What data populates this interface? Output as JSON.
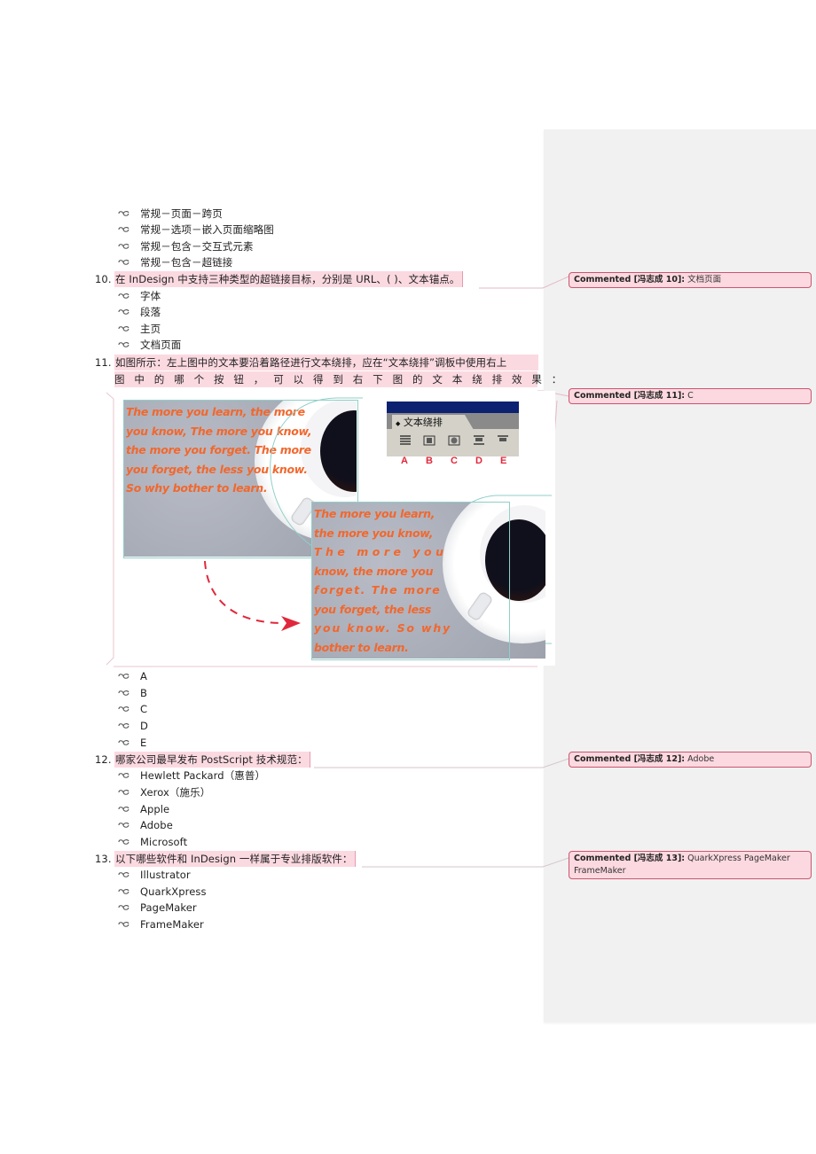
{
  "document": {
    "intro_options": [
      "常规－页面－跨页",
      "常规－选项－嵌入页面缩略图",
      "常规－包含－交互式元素",
      "常规－包含－超链接"
    ],
    "questions": [
      {
        "number": "10.",
        "text": "在 InDesign 中支持三种类型的超链接目标，分别是 URL、(  )、文本锚点。",
        "options": [
          "字体",
          "段落",
          "主页",
          "文档页面"
        ]
      },
      {
        "number": "11.",
        "text_line1": "如图所示：左上图中的文本要沿着路径进行文本绕排，应在“文本绕排”调板中使用右上",
        "text_line2": "图中的哪个按钮，可以得到右下图的文本绕排效果：",
        "options": [
          "A",
          "B",
          "C",
          "D",
          "E"
        ],
        "figure": {
          "sample_text_top": [
            "The more you learn, the more",
            "you know, The more you know,",
            "the more you forget. The more",
            "you forget, the less you know.",
            "So why bother to learn."
          ],
          "sample_text_bottom": [
            "The more you learn,",
            "the more you know,",
            "The  more  you",
            "know, the more you",
            "forget. The more",
            "you forget, the less",
            "you  know.  So  why",
            "bother to learn."
          ],
          "panel_title": "文本绕排",
          "panel_buttons": [
            "A",
            "B",
            "C",
            "D",
            "E"
          ]
        }
      },
      {
        "number": "12.",
        "text": "哪家公司最早发布 PostScript 技术规范：",
        "options": [
          "Hewlett Packard（惠普）",
          "Xerox（施乐）",
          "Apple",
          "Adobe",
          "Microsoft"
        ]
      },
      {
        "number": "13.",
        "text": "以下哪些软件和 InDesign 一样属于专业排版软件：",
        "options": [
          "Illustrator",
          "QuarkXpress",
          "PageMaker",
          "FrameMaker"
        ]
      }
    ]
  },
  "comments": [
    {
      "label": "Commented [冯志成 10]:",
      "text": "文档页面"
    },
    {
      "label": "Commented [冯志成 11]:",
      "text": "C"
    },
    {
      "label": "Commented [冯志成 12]:",
      "text": "Adobe"
    },
    {
      "label": "Commented [冯志成 13]:",
      "text": "QuarkXpress PageMaker",
      "text2": "FrameMaker"
    }
  ],
  "colors": {
    "highlight": "#fbd9e1",
    "comment_border": "#c9566f",
    "comment_pane": "#f1f1f1",
    "sample_text": "#f2672d",
    "panel_letters": "#e0283c"
  }
}
